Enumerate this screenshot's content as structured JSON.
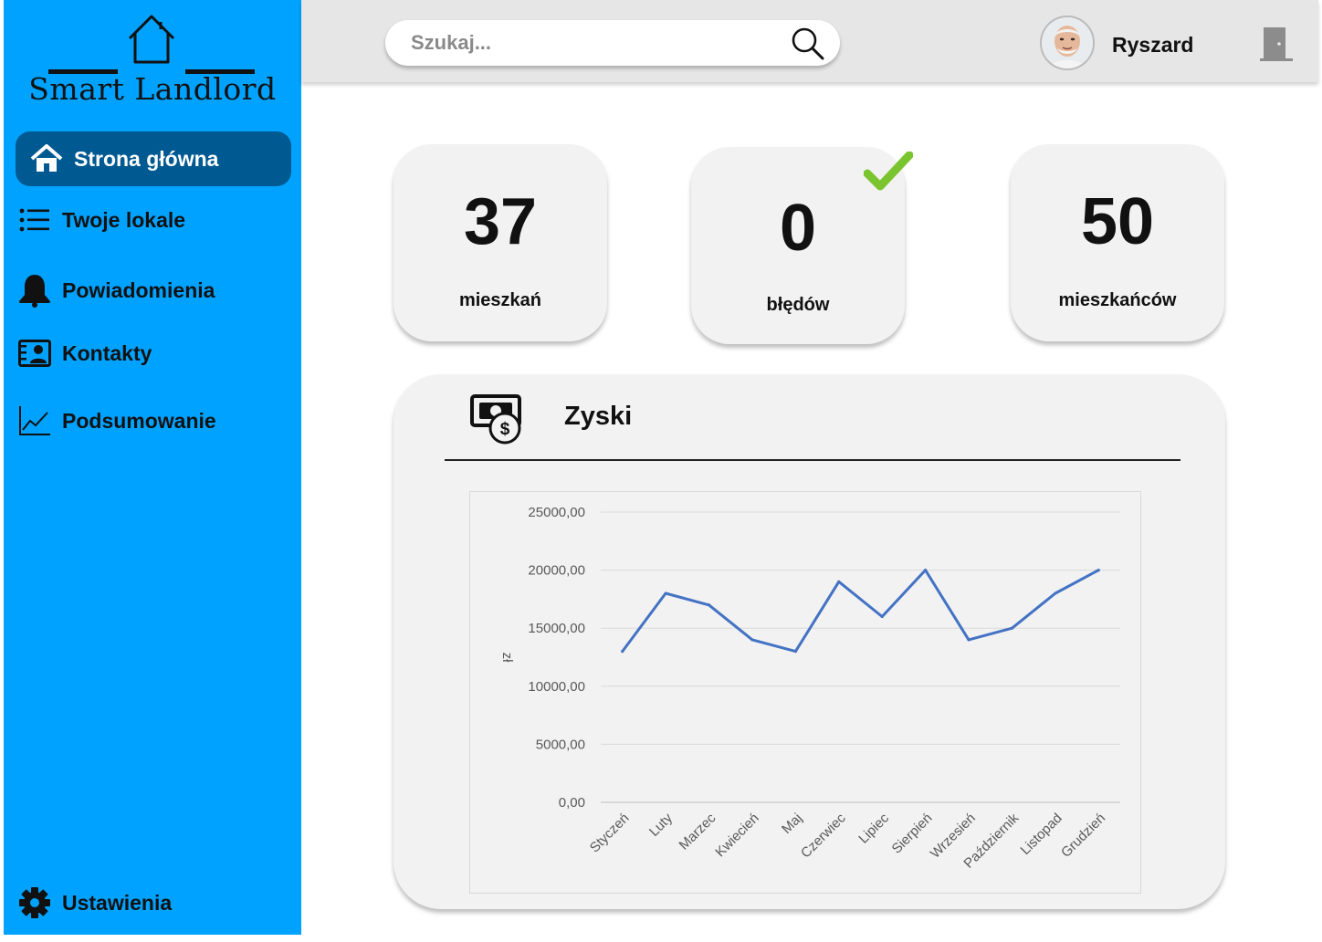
{
  "app": {
    "logo_text": "Smart Landlord"
  },
  "sidebar": {
    "items": [
      {
        "label": "Strona główna",
        "icon": "home-icon",
        "active": true
      },
      {
        "label": "Twoje lokale",
        "icon": "list-icon",
        "active": false
      },
      {
        "label": "Powiadomienia",
        "icon": "bell-icon",
        "active": false
      },
      {
        "label": "Kontakty",
        "icon": "contacts-icon",
        "active": false
      },
      {
        "label": "Podsumowanie",
        "icon": "chart-icon",
        "active": false
      }
    ],
    "settings_label": "Ustawienia",
    "settings_icon": "gear-icon"
  },
  "header": {
    "search_placeholder": "Szukaj...",
    "search_icon": "search-icon",
    "username": "Ryszard",
    "logout_icon": "door-icon"
  },
  "stats": [
    {
      "value": "37",
      "label": "mieszkań"
    },
    {
      "value": "0",
      "label": "błędów",
      "status_icon": "check-icon"
    },
    {
      "value": "50",
      "label": "mieszkańców"
    }
  ],
  "colors": {
    "sidebar": "#00a2ff",
    "active_item": "#005a91",
    "line": "#4472c4",
    "check": "#7ac52f"
  },
  "profit_panel": {
    "title": "Zyski",
    "icon": "money-icon"
  },
  "chart_data": {
    "type": "line",
    "title": "",
    "xlabel": "",
    "ylabel": "zł",
    "categories": [
      "Styczeń",
      "Luty",
      "Marzec",
      "Kwiecień",
      "Maj",
      "Czerwiec",
      "Lipiec",
      "Sierpień",
      "Wrzesień",
      "Październik",
      "Listopad",
      "Grudzień"
    ],
    "values": [
      13000,
      18000,
      17000,
      14000,
      13000,
      19000,
      16000,
      20000,
      14000,
      15000,
      18000,
      20000
    ],
    "ylim": [
      0,
      25000
    ],
    "y_ticks": [
      "0,00",
      "5000,00",
      "10000,00",
      "15000,00",
      "20000,00",
      "25000,00"
    ],
    "grid": true,
    "legend": "none"
  }
}
